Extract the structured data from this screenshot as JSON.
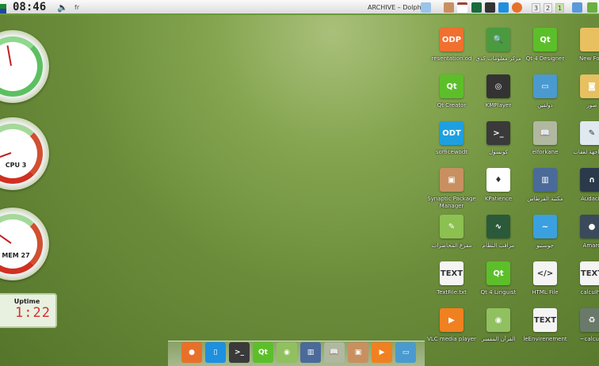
{
  "topbar": {
    "clock": "08:46",
    "lang": "fr",
    "window_title": "ARCHIVE – Dolphin",
    "desktops": [
      "3",
      "2",
      "1"
    ]
  },
  "widgets": {
    "cpu_label": "CPU 3",
    "mem_label": "MEM 27",
    "uptime_title": "Uptime",
    "uptime_value": "1:22"
  },
  "desktop_icons": [
    {
      "label": "resentation.od",
      "icon": "odp-icon",
      "color": "#f07030",
      "glyph": "ODP"
    },
    {
      "label": "Qt Creator",
      "icon": "qt-creator-icon",
      "color": "#5cbf2a",
      "glyph": "Qt"
    },
    {
      "label": "sofficewodt",
      "icon": "odt-icon",
      "color": "#1ea0e0",
      "glyph": "ODT"
    },
    {
      "label": "Synaptic Package Manager",
      "icon": "package-icon",
      "color": "#c89060",
      "glyph": "▣"
    },
    {
      "label": "مفرغ المحاضرات",
      "icon": "audio-edit-icon",
      "color": "#8cc050",
      "glyph": "✎"
    },
    {
      "label": "TextFile.txt",
      "icon": "text-file-icon",
      "color": "#f4f4f4",
      "glyph": "TEXT"
    },
    {
      "label": "VLC media player",
      "icon": "vlc-icon",
      "color": "#f08020",
      "glyph": "▶"
    },
    {
      "label": "مركز معلومات كدي",
      "icon": "kinfocenter-icon",
      "color": "#4a9a40",
      "glyph": "🔍"
    },
    {
      "label": "KMPlayer",
      "icon": "kmplayer-icon",
      "color": "#333333",
      "glyph": "◎"
    },
    {
      "label": "كونسول",
      "icon": "konsole-icon",
      "color": "#3a3a3a",
      "glyph": ">_"
    },
    {
      "label": "KPatience",
      "icon": "cards-icon",
      "color": "#ffffff",
      "glyph": "♦"
    },
    {
      "label": "مراقب النظام",
      "icon": "system-monitor-icon",
      "color": "#2a5a3a",
      "glyph": "∿"
    },
    {
      "label": "Qt 4 Linguist",
      "icon": "qt-linguist-icon",
      "color": "#5cbf2a",
      "glyph": "Qt"
    },
    {
      "label": "القرآن المفسر",
      "icon": "quran-icon",
      "color": "#90c060",
      "glyph": "◉"
    },
    {
      "label": "Qt 4 Designer",
      "icon": "qt-designer-icon",
      "color": "#5cbf2a",
      "glyph": "Qt"
    },
    {
      "label": "دولفين",
      "icon": "dolphin-icon",
      "color": "#4a9ad0",
      "glyph": "▭"
    },
    {
      "label": "elforkane",
      "icon": "book-icon",
      "color": "#b0b8a0",
      "glyph": "📖"
    },
    {
      "label": "مكتبة القرطاس",
      "icon": "library-icon",
      "color": "#4a6a9a",
      "glyph": "▥"
    },
    {
      "label": "جوستيو",
      "icon": "game-icon",
      "color": "#3aa0e0",
      "glyph": "~"
    },
    {
      "label": "HTML File",
      "icon": "html-file-icon",
      "color": "#f4f4f4",
      "glyph": "</>"
    },
    {
      "label": "leEnvirenement",
      "icon": "text-file-icon",
      "color": "#f4f4f4",
      "glyph": "TEXT"
    },
    {
      "label": "New Fold",
      "icon": "folder-icon",
      "color": "#e8c060",
      "glyph": ""
    },
    {
      "label": "صور",
      "icon": "pictures-folder-icon",
      "color": "#e8c060",
      "glyph": "◙"
    },
    {
      "label": "ات واجهة لعقاب",
      "icon": "settings-icon",
      "color": "#e0e8f0",
      "glyph": "✎"
    },
    {
      "label": "Audacio",
      "icon": "audacious-icon",
      "color": "#2a3a4a",
      "glyph": "∩"
    },
    {
      "label": "Amaro",
      "icon": "amarok-icon",
      "color": "#3a4a5a",
      "glyph": "●"
    },
    {
      "label": "calculho",
      "icon": "text-file-icon",
      "color": "#f4f4f4",
      "glyph": "TEXT"
    },
    {
      "label": "~calculh",
      "icon": "trash-icon",
      "color": "#6a7a6a",
      "glyph": "♻"
    }
  ],
  "dock": [
    {
      "icon": "firefox-icon",
      "color": "#e8702a",
      "glyph": "●"
    },
    {
      "icon": "writer-icon",
      "color": "#1e90e0",
      "glyph": "▯"
    },
    {
      "icon": "konsole-icon",
      "color": "#3a3a3a",
      "glyph": ">_"
    },
    {
      "icon": "qt-creator-icon",
      "color": "#5cbf2a",
      "glyph": "Qt"
    },
    {
      "icon": "quran-icon",
      "color": "#90c060",
      "glyph": "◉"
    },
    {
      "icon": "library-icon",
      "color": "#4a6a9a",
      "glyph": "▥"
    },
    {
      "icon": "book-icon",
      "color": "#b0b8a0",
      "glyph": "📖"
    },
    {
      "icon": "package-icon",
      "color": "#c89060",
      "glyph": "▣"
    },
    {
      "icon": "vlc-icon",
      "color": "#f08020",
      "glyph": "▶"
    },
    {
      "icon": "dolphin-icon",
      "color": "#4a9ad0",
      "glyph": "▭"
    }
  ]
}
